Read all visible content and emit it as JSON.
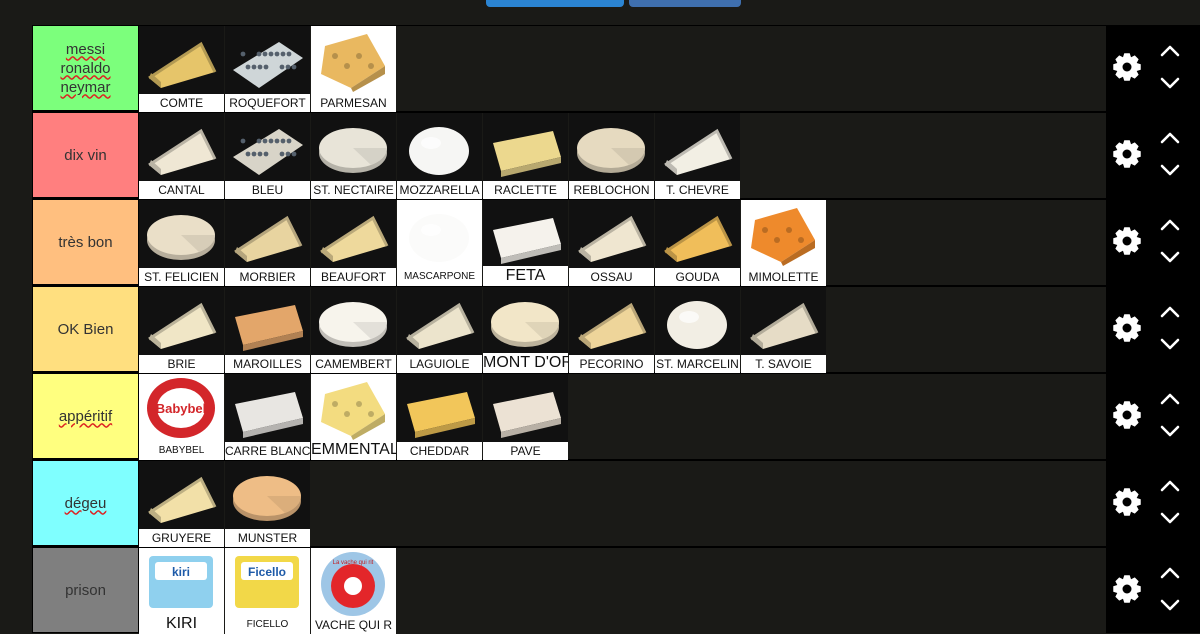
{
  "tiers": [
    {
      "labels": [
        "messi",
        "ronaldo",
        "neymar"
      ],
      "spell": true,
      "color": "#7cff7c",
      "items": [
        {
          "name": "COMTE",
          "cheese": "#e6c56a",
          "shape": "wedge"
        },
        {
          "name": "ROQUEFORT",
          "cheese": "#cfd6d8",
          "shape": "blue"
        },
        {
          "name": "PARMESAN",
          "cheese": "#e9b860",
          "shape": "chunk",
          "bg": "white"
        }
      ]
    },
    {
      "labels": [
        "dix vin"
      ],
      "spell": false,
      "color": "#ff7f7f",
      "items": [
        {
          "name": "CANTAL",
          "cheese": "#efe7d4",
          "shape": "wedge"
        },
        {
          "name": "BLEU",
          "cheese": "#d8d4c8",
          "shape": "blue"
        },
        {
          "name": "ST. NECTAIRE",
          "cheese": "#e8e4d8",
          "shape": "wheel"
        },
        {
          "name": "MOZZARELLA",
          "cheese": "#f6f6f4",
          "shape": "ball"
        },
        {
          "name": "RACLETTE",
          "cheese": "#ecd88e",
          "shape": "slab"
        },
        {
          "name": "REBLOCHON",
          "cheese": "#e6dac0",
          "shape": "wheel"
        },
        {
          "name": "T. CHEVRE",
          "cheese": "#f2efe4",
          "shape": "wedge"
        }
      ]
    },
    {
      "labels": [
        "très bon"
      ],
      "spell": false,
      "color": "#ffbf7f",
      "items": [
        {
          "name": "ST. FELICIEN",
          "cheese": "#eadfc8",
          "shape": "wheel"
        },
        {
          "name": "MORBIER",
          "cheese": "#e8d4a0",
          "shape": "wedge"
        },
        {
          "name": "BEAUFORT",
          "cheese": "#eed99c",
          "shape": "wedge"
        },
        {
          "name": "MASCARPONE",
          "cheese": "#fbfbfa",
          "shape": "ball",
          "bg": "white",
          "small": true
        },
        {
          "name": "FETA",
          "cheese": "#f5f2ec",
          "shape": "slab",
          "big": true
        },
        {
          "name": "OSSAU",
          "cheese": "#efe6d0",
          "shape": "wedge"
        },
        {
          "name": "GOUDA",
          "cheese": "#f0be5a",
          "shape": "wedge"
        },
        {
          "name": "MIMOLETTE",
          "cheese": "#ee8a2c",
          "shape": "chunk",
          "bg": "white"
        }
      ]
    },
    {
      "labels": [
        "OK Bien"
      ],
      "spell": false,
      "color": "#ffdf7f",
      "items": [
        {
          "name": "BRIE",
          "cheese": "#f0e6c6",
          "shape": "wedge"
        },
        {
          "name": "MAROILLES",
          "cheese": "#e3a66a",
          "shape": "slab"
        },
        {
          "name": "CAMEMBERT",
          "cheese": "#f7f4ec",
          "shape": "wheel"
        },
        {
          "name": "LAGUIOLE",
          "cheese": "#ece4cc",
          "shape": "wedge"
        },
        {
          "name": "MONT D'OR",
          "cheese": "#f2e6c8",
          "shape": "wheel",
          "big": true
        },
        {
          "name": "PECORINO",
          "cheese": "#eed59a",
          "shape": "wedge"
        },
        {
          "name": "ST. MARCELIN",
          "cheese": "#f2eee4",
          "shape": "ball"
        },
        {
          "name": "T. SAVOIE",
          "cheese": "#e6dcc6",
          "shape": "wedge"
        }
      ]
    },
    {
      "labels": [
        "appéritif"
      ],
      "spell": true,
      "color": "#ffff7f",
      "items": [
        {
          "name": "BABYBEL",
          "cheese": "#d3262a",
          "shape": "logo",
          "bg": "white",
          "small": true,
          "logo_text": "Babybel"
        },
        {
          "name": "CARRE BLANC",
          "cheese": "#e8e6e2",
          "shape": "slab"
        },
        {
          "name": "EMMENTAL",
          "cheese": "#f3dc80",
          "shape": "chunk",
          "bg": "white",
          "big": true
        },
        {
          "name": "CHEDDAR",
          "cheese": "#f2c65a",
          "shape": "slab"
        },
        {
          "name": "PAVE",
          "cheese": "#ece2d4",
          "shape": "slab"
        }
      ]
    },
    {
      "labels": [
        "dégeu"
      ],
      "spell": true,
      "color": "#7fffff",
      "items": [
        {
          "name": "GRUYERE",
          "cheese": "#f2e0a8",
          "shape": "wedge"
        },
        {
          "name": "MUNSTER",
          "cheese": "#eebd86",
          "shape": "wheel"
        }
      ]
    },
    {
      "labels": [
        "prison"
      ],
      "spell": false,
      "color": "#7f7f7f",
      "items": [
        {
          "name": "KIRI",
          "cheese": "#8fd0ee",
          "shape": "box",
          "bg": "white",
          "big": true,
          "logo_text": "kiri"
        },
        {
          "name": "FICELLO",
          "cheese": "#f2d848",
          "shape": "box",
          "bg": "white",
          "small": true,
          "logo_text": "Ficello"
        },
        {
          "name": "VACHE QUI R",
          "cheese": "#e3262a",
          "shape": "round",
          "bg": "white",
          "logo_text": "La vache qui rit"
        }
      ]
    }
  ],
  "controls": {
    "gear_icon": "gear-icon",
    "up_icon": "chevron-up-icon",
    "down_icon": "chevron-down-icon"
  },
  "colors": {
    "background": "#1a1a17",
    "controls": "#000000",
    "caption": "#ffffff"
  }
}
